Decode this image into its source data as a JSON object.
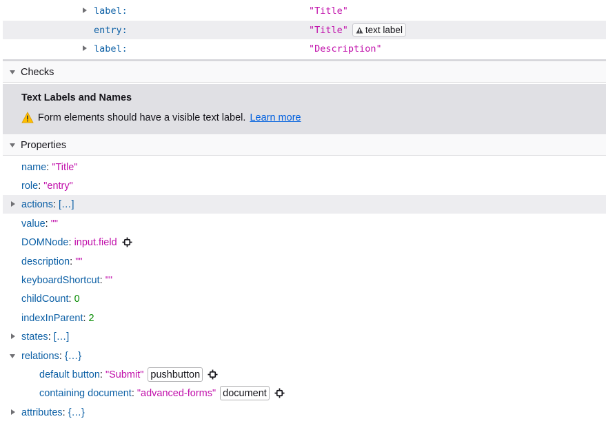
{
  "tree": {
    "rows": [
      {
        "key": "label:",
        "value": "\"Title\"",
        "expandable": true
      },
      {
        "key": "entry:",
        "value": "\"Title\"",
        "badge": "text label",
        "selected": true
      },
      {
        "key": "label:",
        "value": "\"Description\"",
        "expandable": true
      }
    ]
  },
  "checks": {
    "header": "Checks",
    "title": "Text Labels and Names",
    "message": "Form elements should have a visible text label.",
    "link": "Learn more"
  },
  "properties": {
    "header": "Properties",
    "name_key": "name",
    "name_val": "\"Title\"",
    "role_key": "role",
    "role_val": "\"entry\"",
    "actions_key": "actions",
    "actions_val": "[…]",
    "value_key": "value",
    "value_val": "\"\"",
    "domnode_key": "DOMNode",
    "domnode_val": "input.field",
    "description_key": "description",
    "description_val": "\"\"",
    "shortcut_key": "keyboardShortcut",
    "shortcut_val": "\"\"",
    "childcount_key": "childCount",
    "childcount_val": "0",
    "index_key": "indexInParent",
    "index_val": "2",
    "states_key": "states",
    "states_val": "[…]",
    "relations_key": "relations",
    "relations_val": "{…}",
    "default_button_key": "default button",
    "default_button_val": "\"Submit\"",
    "default_button_badge": "pushbutton",
    "containing_doc_key": "containing document",
    "containing_doc_val": "\"advanced-forms\"",
    "containing_doc_badge": "document",
    "attributes_key": "attributes",
    "attributes_val": "{…}"
  },
  "colors": {
    "key": "#0b5fa5",
    "string": "#c00eaa",
    "number": "#058b00",
    "link": "#0060df",
    "warning": "#ffbf00"
  },
  "icons": {
    "expand": "triangle-right-icon",
    "collapse": "triangle-down-icon",
    "warning": "warning-icon",
    "inspect": "inspect-node-icon"
  }
}
